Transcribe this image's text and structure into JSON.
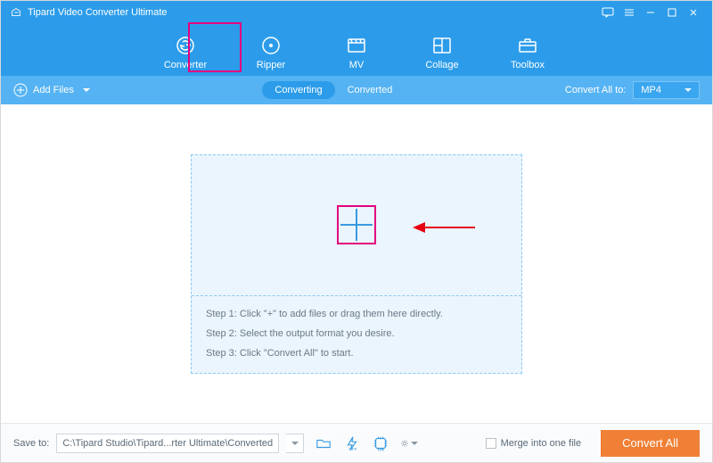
{
  "title": "Tipard Video Converter Ultimate",
  "nav": {
    "items": [
      {
        "label": "Converter"
      },
      {
        "label": "Ripper"
      },
      {
        "label": "MV"
      },
      {
        "label": "Collage"
      },
      {
        "label": "Toolbox"
      }
    ]
  },
  "toolbar": {
    "add_files_label": "Add Files",
    "converting_label": "Converting",
    "converted_label": "Converted",
    "convert_all_to_label": "Convert All to:",
    "format_selected": "MP4"
  },
  "dropzone": {
    "step1": "Step 1: Click \"+\" to add files or drag them here directly.",
    "step2": "Step 2: Select the output format you desire.",
    "step3": "Step 3: Click \"Convert All\" to start."
  },
  "bottombar": {
    "save_to_label": "Save to:",
    "save_path": "C:\\Tipard Studio\\Tipard...rter Ultimate\\Converted",
    "merge_label": "Merge into one file",
    "convert_all_btn": "Convert All"
  }
}
